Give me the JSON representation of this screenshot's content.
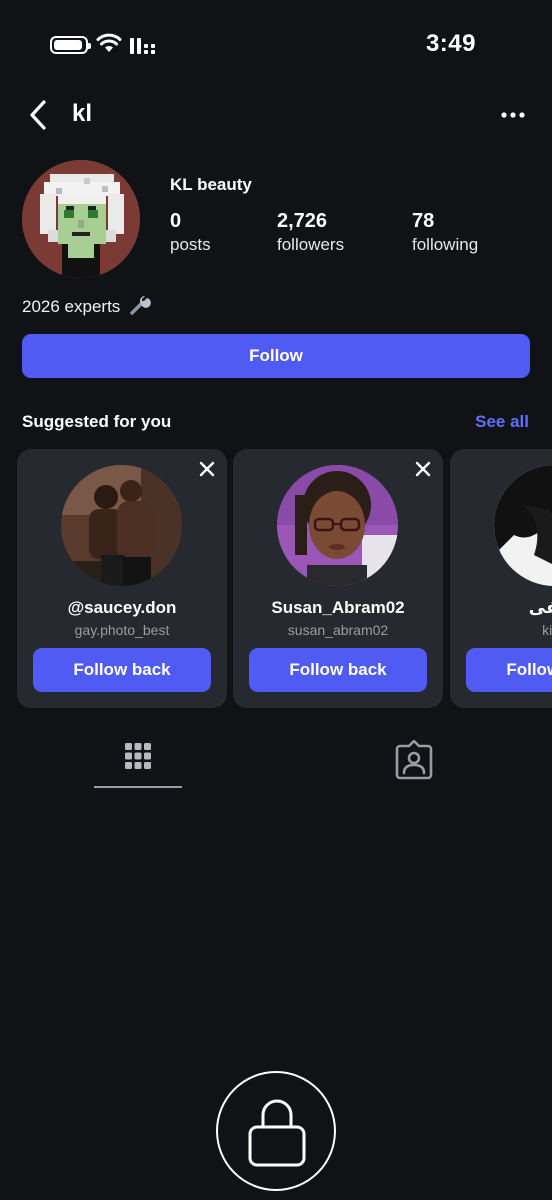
{
  "status_bar": {
    "time": "3:49"
  },
  "header": {
    "username": "kl"
  },
  "profile": {
    "display_name": "KL beauty",
    "stats": [
      {
        "value": "0",
        "label": "posts"
      },
      {
        "value": "2,726",
        "label": "followers"
      },
      {
        "value": "78",
        "label": "following"
      }
    ],
    "bio": "2026 experts",
    "follow_label": "Follow"
  },
  "suggested": {
    "title": "Suggested for you",
    "see_all": "See all",
    "cards": [
      {
        "name": "@saucey.don",
        "handle": "gay.photo_best",
        "button": "Follow back"
      },
      {
        "name": "Susan_Abram02",
        "handle": "susan_abram02",
        "button": "Follow back"
      },
      {
        "name": "لطفی",
        "handle": "kitte",
        "button": "Follow back"
      }
    ]
  },
  "colors": {
    "background": "#101216",
    "card": "#26292f",
    "accent": "#4f5bf3",
    "link": "#5d70ff"
  }
}
